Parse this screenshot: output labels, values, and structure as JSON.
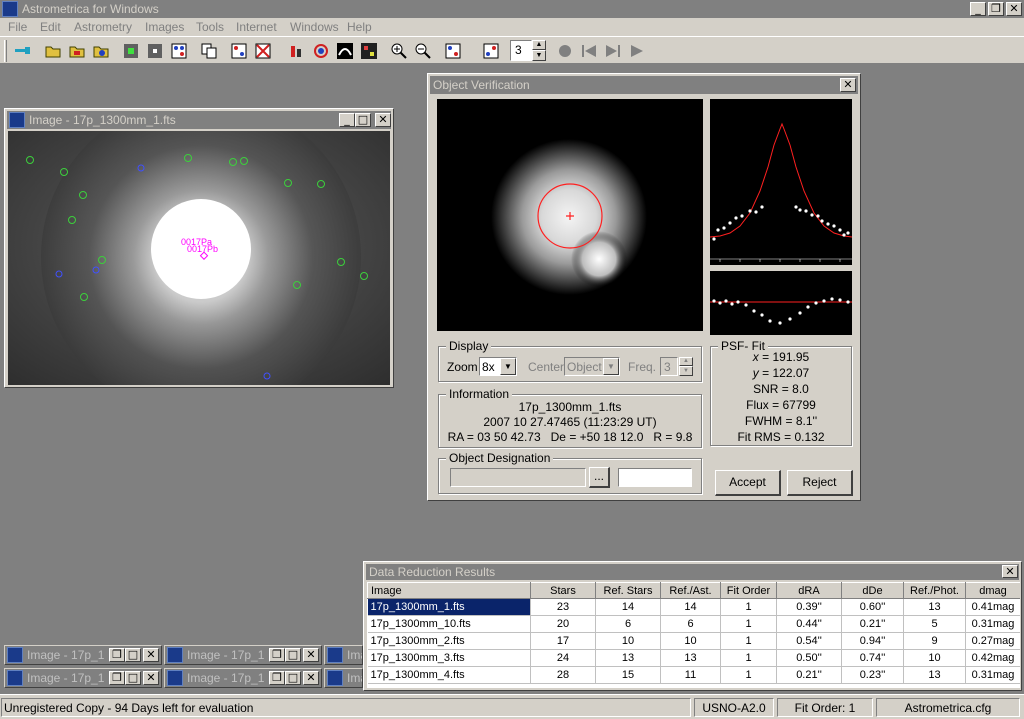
{
  "app": {
    "title": "Astrometrica for Windows",
    "menu": [
      "File",
      "Edit",
      "Astrometry",
      "Images",
      "Tools",
      "Internet",
      "Windows",
      "Help"
    ],
    "toolbar": {
      "icons": [
        "key-icon",
        "open-folder-icon",
        "open-folder-2-icon",
        "open-dice-icon",
        "star-plus-icon",
        "star-minus-icon",
        "dice-icon",
        "copy-icon",
        "dice-red-icon",
        "dice-cross-icon",
        "color-bars-icon",
        "circle-icon",
        "wave-icon",
        "grid-icon",
        "zoom-in-icon",
        "zoom-out-icon",
        "dice-blue-icon",
        "dice-blue-2-icon"
      ],
      "spin_value": "3"
    }
  },
  "image_window": {
    "title": "Image - 17p_1300mm_1.fts",
    "labels": [
      "0017Pa",
      "0017Pb"
    ]
  },
  "dialog": {
    "title": "Object Verification",
    "display": {
      "group_label": "Display",
      "zoom_label": "Zoom",
      "zoom_value": "8x",
      "center_label": "Center",
      "center_value": "Object",
      "freq_label": "Freq.",
      "freq_value": "3"
    },
    "psf": {
      "group_label": "PSF- Fit",
      "x_label": "x",
      "x_value": "= 191.95",
      "y_label": "y",
      "y_value": "= 122.07",
      "snr": "SNR = 8.0",
      "flux": "Flux = 67799",
      "fwhm": "FWHM = 8.1''",
      "fitrms": "Fit RMS = 0.132"
    },
    "info": {
      "group_label": "Information",
      "line1": "17p_1300mm_1.fts",
      "line2": "2007 10 27.47465 (11:23:29 UT)",
      "line3": "RA = 03 50 42.73   De = +50 18 12.0   R = 9.8"
    },
    "designation": {
      "group_label": "Object Designation",
      "browse_label": "..."
    },
    "accept_label": "Accept",
    "reject_label": "Reject"
  },
  "results": {
    "title": "Data Reduction Results",
    "columns": [
      "Image",
      "Stars",
      "Ref. Stars",
      "Ref./Ast.",
      "Fit Order",
      "dRA",
      "dDe",
      "Ref./Phot.",
      "dmag"
    ],
    "rows": [
      [
        "17p_1300mm_1.fts",
        "23",
        "14",
        "14",
        "1",
        "0.39''",
        "0.60''",
        "13",
        "0.41mag"
      ],
      [
        "17p_1300mm_10.fts",
        "20",
        "6",
        "6",
        "1",
        "0.44''",
        "0.21''",
        "5",
        "0.31mag"
      ],
      [
        "17p_1300mm_2.fts",
        "17",
        "10",
        "10",
        "1",
        "0.54''",
        "0.94''",
        "9",
        "0.27mag"
      ],
      [
        "17p_1300mm_3.fts",
        "24",
        "13",
        "13",
        "1",
        "0.50''",
        "0.74''",
        "10",
        "0.42mag"
      ],
      [
        "17p_1300mm_4.fts",
        "28",
        "15",
        "11",
        "1",
        "0.21''",
        "0.23''",
        "13",
        "0.31mag"
      ]
    ]
  },
  "minimized": {
    "label": "Image - 17p_1"
  },
  "status": {
    "message": "Unregistered Copy - 94 Days left for evaluation",
    "catalog": "USNO-A2.0",
    "fit_order": "Fit Order: 1",
    "config": "Astrometrica.cfg"
  },
  "colors": {
    "title_active": "#0a246a",
    "title_inactive": "#808080",
    "face": "#d4d0c8",
    "workspace": "#808080",
    "ref_star": "#3cd03c",
    "unknown_star": "#4050ff",
    "asteroid": "#ff00ff",
    "psf_curve": "#ff2020"
  }
}
